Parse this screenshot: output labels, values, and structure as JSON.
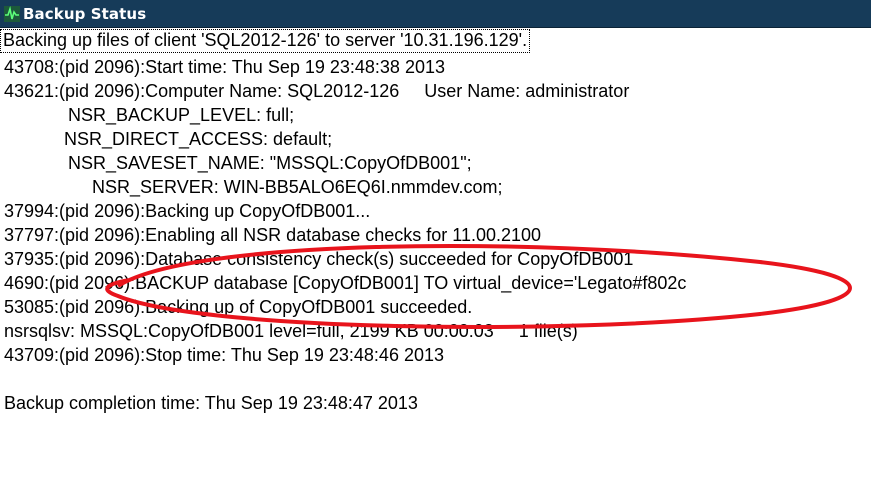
{
  "window": {
    "title": "Backup Status",
    "icon": "pulse-icon"
  },
  "log_lines": [
    "Backing up files of client 'SQL2012-126' to server '10.31.196.129'.",
    "43708:(pid 2096):Start time: Thu Sep 19 23:48:38 2013",
    "43621:(pid 2096):Computer Name: SQL2012-126     User Name: administrator",
    "NSR_BACKUP_LEVEL: full;",
    "NSR_DIRECT_ACCESS: default;",
    "NSR_SAVESET_NAME: \"MSSQL:CopyOfDB001\";",
    "NSR_SERVER: WIN-BB5ALO6EQ6I.nmmdev.com;",
    "37994:(pid 2096):Backing up CopyOfDB001...",
    "37797:(pid 2096):Enabling all NSR database checks for 11.00.2100",
    "37935:(pid 2096):Database consistency check(s) succeeded for CopyOfDB001",
    "4690:(pid 2096):BACKUP database [CopyOfDB001] TO virtual_device='Legato#f802c",
    "53085:(pid 2096):Backing up of CopyOfDB001 succeeded.",
    "nsrsqlsv: MSSQL:CopyOfDB001 level=full, 2199 KB 00:00:03     1 file(s)",
    "43709:(pid 2096):Stop time: Thu Sep 19 23:48:46 2013",
    "",
    "Backup completion time: Thu Sep 19 23:48:47 2013"
  ],
  "colors": {
    "titlebar": "#163b59",
    "annotation": "#e8141c"
  }
}
